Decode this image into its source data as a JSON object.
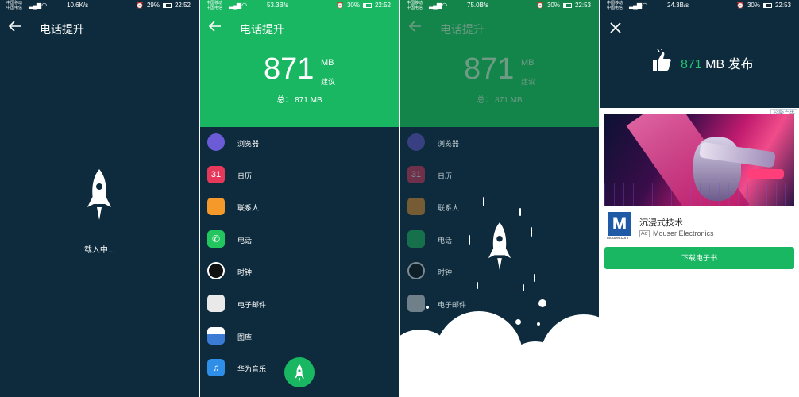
{
  "status_bars": [
    {
      "carrier1": "中国移动",
      "carrier2": "中国电信",
      "speed": "10.6K/s",
      "battery": "29%",
      "time": "22:52"
    },
    {
      "carrier1": "中国移动",
      "carrier2": "中国电信",
      "speed": "53.3B/s",
      "battery": "30%",
      "time": "22:52"
    },
    {
      "carrier1": "中国移动",
      "carrier2": "中国电信",
      "speed": "75.0B/s",
      "battery": "30%",
      "time": "22:53"
    },
    {
      "carrier1": "中国移动",
      "carrier2": "中国电信",
      "speed": "24.3B/s",
      "battery": "30%",
      "time": "22:53"
    }
  ],
  "screen1": {
    "title": "电话提升",
    "loading_text": "载入中..."
  },
  "screen2": {
    "title": "电话提升",
    "size_value": "871",
    "size_unit": "MB",
    "suggest_label": "建议",
    "total_text": "总： 871 MB",
    "apps": [
      {
        "label": "浏览器",
        "icon": "browser-icon",
        "color": "#6c5bd6"
      },
      {
        "label": "日历",
        "icon": "calendar-icon",
        "color": "#e6385a"
      },
      {
        "label": "联系人",
        "icon": "contacts-icon",
        "color": "#f59a2a"
      },
      {
        "label": "电话",
        "icon": "phone-icon",
        "color": "#22c55e"
      },
      {
        "label": "时钟",
        "icon": "clock-icon",
        "color": "#111111"
      },
      {
        "label": "电子邮件",
        "icon": "email-icon",
        "color": "#e9e9e9"
      },
      {
        "label": "图库",
        "icon": "gallery-icon",
        "color": "#3b7bd6"
      },
      {
        "label": "华为音乐",
        "icon": "music-icon",
        "color": "#2f8fe8"
      }
    ]
  },
  "screen3": {
    "title": "电话提升",
    "size_value": "871",
    "size_unit": "MB",
    "suggest_label": "建议",
    "total_text": "总： 871 MB",
    "apps": [
      {
        "label": "浏览器"
      },
      {
        "label": "日历"
      },
      {
        "label": "联系人"
      },
      {
        "label": "电话"
      },
      {
        "label": "时钟"
      },
      {
        "label": "电子邮件"
      }
    ]
  },
  "screen4": {
    "released_value": "871",
    "released_text": " MB 发布",
    "ad_tag": "谷歌广告",
    "ad_title": "沉浸式技术",
    "ad_badge": "Ad",
    "ad_sponsor": "Mouser Electronics",
    "ad_logo_letter": "M",
    "ad_logo_sub": "mouser.com",
    "ad_button": "下载电子书"
  },
  "colors": {
    "dark_bg": "#0d2b3c",
    "accent_green": "#1ab763",
    "released_green": "#23c26f"
  }
}
